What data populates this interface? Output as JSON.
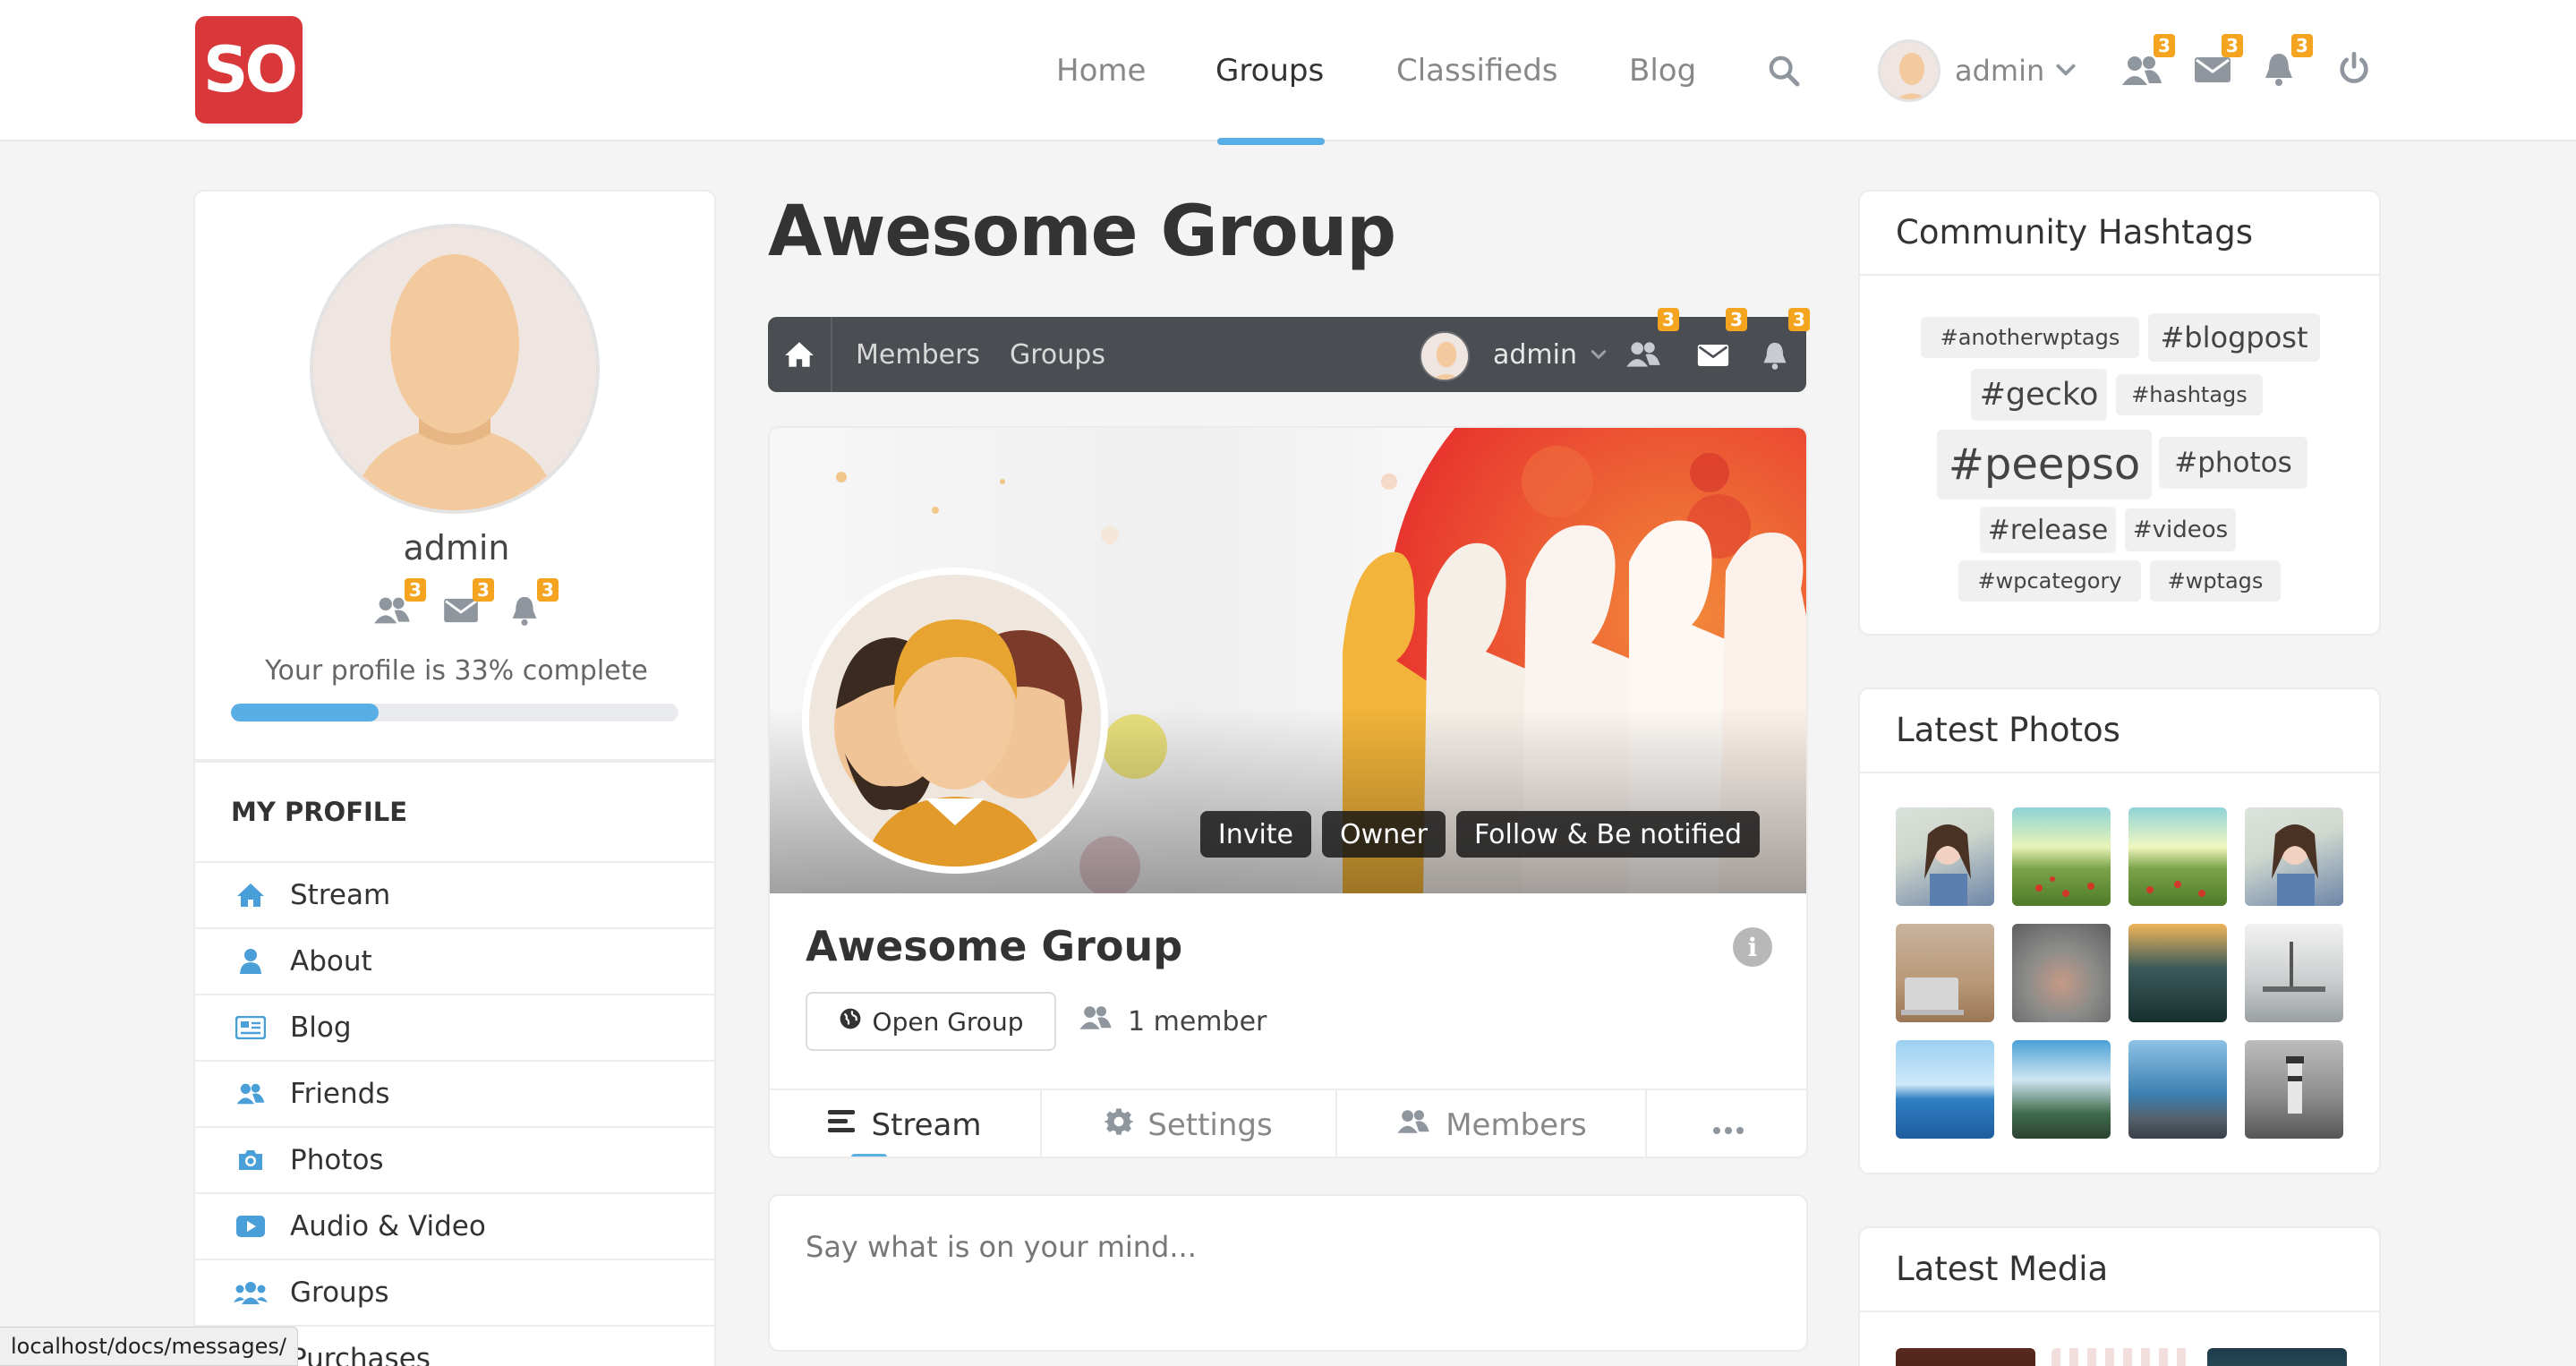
{
  "header": {
    "logo_text": "SO",
    "nav": [
      {
        "label": "Home"
      },
      {
        "label": "Groups"
      },
      {
        "label": "Classifieds"
      },
      {
        "label": "Blog"
      }
    ],
    "user_name": "admin",
    "badges": {
      "friends": "3",
      "messages": "3",
      "notifications": "3"
    },
    "icons": [
      "search-icon",
      "friends-icon",
      "envelope-icon",
      "bell-icon",
      "power-icon"
    ]
  },
  "sidebar": {
    "name": "admin",
    "badges": {
      "friends": "3",
      "messages": "3",
      "notifications": "3"
    },
    "completion_text": "Your profile is 33% complete",
    "completion_percent": 33,
    "section_title": "MY PROFILE",
    "items": [
      {
        "label": "Stream",
        "icon": "home-icon"
      },
      {
        "label": "About",
        "icon": "user-icon"
      },
      {
        "label": "Blog",
        "icon": "blog-icon"
      },
      {
        "label": "Friends",
        "icon": "friends-icon"
      },
      {
        "label": "Photos",
        "icon": "camera-icon"
      },
      {
        "label": "Audio & Video",
        "icon": "video-icon"
      },
      {
        "label": "Groups",
        "icon": "groups-icon"
      },
      {
        "label": "Purchases",
        "icon": "cart-icon"
      }
    ]
  },
  "group": {
    "title": "Awesome Group",
    "nav": {
      "members": "Members",
      "groups": "Groups",
      "user_name": "admin",
      "badges": {
        "friends": "3",
        "messages": "3",
        "notifications": "3"
      }
    },
    "cover_buttons": [
      "Invite",
      "Owner",
      "Follow & Be notified"
    ],
    "name": "Awesome Group",
    "privacy": "Open Group",
    "members": "1 member",
    "tabs": [
      {
        "label": "Stream",
        "icon": "stream-icon"
      },
      {
        "label": "Settings",
        "icon": "gear-icon"
      },
      {
        "label": "Members",
        "icon": "members-icon"
      },
      {
        "label": "",
        "icon": "more-icon"
      }
    ],
    "post_placeholder": "Say what is on your mind..."
  },
  "hashtags": {
    "title": "Community Hashtags",
    "tags": [
      "#anotherwptags",
      "#blogpost",
      "#gecko",
      "#hashtags",
      "#peepso",
      "#photos",
      "#release",
      "#videos",
      "#wpcategory",
      "#wptags"
    ]
  },
  "photos": {
    "title": "Latest Photos",
    "items": [
      "woman-photo",
      "field-photo",
      "field-photo",
      "woman-photo",
      "laptop-photo",
      "cat-photo",
      "forest-photo",
      "lamp-photo",
      "sea-photo",
      "cliff-photo",
      "coast-photo",
      "lighthouse-photo"
    ]
  },
  "media": {
    "title": "Latest Media"
  },
  "status_bar": "localhost/docs/messages/",
  "colors": {
    "accent": "#5aaee6",
    "logo": "#d9383a",
    "badge": "#f4a41e",
    "group_nav": "#4a4d52"
  }
}
